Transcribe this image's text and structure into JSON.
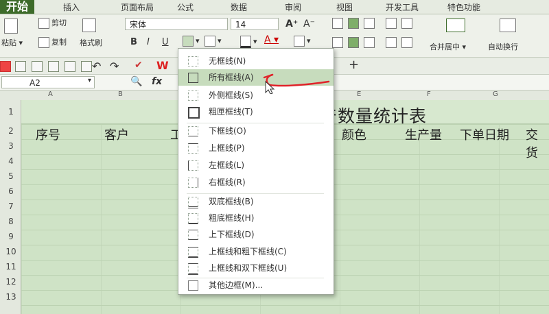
{
  "menu_tabs": [
    "开始",
    "插入",
    "页面布局",
    "公式",
    "数据",
    "审阅",
    "视图",
    "开发工具",
    "特色功能"
  ],
  "ribbon": {
    "paste": "粘贴",
    "cut": "剪切",
    "copy": "复制",
    "format_painter": "格式刷",
    "font_name": "宋体",
    "font_size": "14",
    "bold": "B",
    "italic": "I",
    "underline": "U",
    "grow": "A⁺",
    "shrink": "A⁻",
    "merge_center": "合并居中",
    "wrap_text": "自动换行"
  },
  "formula_bar": {
    "name_box": "A2",
    "fx": "fx"
  },
  "columns": [
    "A",
    "B",
    "E",
    "F",
    "G"
  ],
  "rows": [
    "1",
    "2",
    "3",
    "4",
    "5",
    "6",
    "7",
    "8",
    "9",
    "10",
    "11",
    "12",
    "13"
  ],
  "sheet": {
    "title": "生产数量统计表",
    "headers": [
      "序号",
      "客户",
      "工",
      "颜色",
      "生产量",
      "下单日期",
      "交货"
    ]
  },
  "border_menu": {
    "items": [
      "无框线(N)",
      "所有框线(A)",
      "外侧框线(S)",
      "粗匣框线(T)",
      "下框线(O)",
      "上框线(P)",
      "左框线(L)",
      "右框线(R)",
      "双底框线(B)",
      "粗底框线(H)",
      "上下框线(D)",
      "上框线和粗下框线(C)",
      "上框线和双下框线(U)",
      "其他边框(M)..."
    ],
    "highlighted_index": 1
  },
  "colors": {
    "accent": "#3d6b2a",
    "highlight": "#c7dcbd",
    "annotation": "#e0232a"
  }
}
